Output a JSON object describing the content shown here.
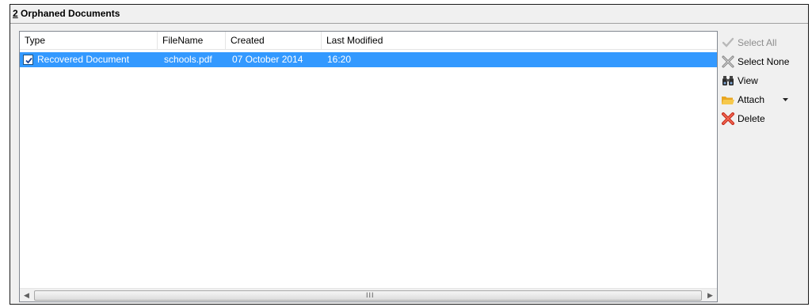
{
  "panel": {
    "number": "2",
    "title": "Orphaned Documents"
  },
  "list": {
    "columns": [
      "Type",
      "FileName",
      "Created",
      "Last Modified"
    ],
    "rows": [
      {
        "checked": true,
        "type": "Recovered Document",
        "filename": "schools.pdf",
        "created": "07 October 2014",
        "last_modified": "16:20"
      }
    ]
  },
  "actions": {
    "select_all": "Select All",
    "select_none": "Select None",
    "view": "View",
    "attach": "Attach",
    "delete": "Delete"
  },
  "colors": {
    "selection": "#3399ff",
    "disabled_text": "#8d8d8d",
    "delete_icon": "#e8402a",
    "folder_icon": "#f2b737"
  },
  "icons": {
    "select_all": "check-icon",
    "select_none": "cross-icon",
    "view": "binoculars-icon",
    "attach": "folder-icon",
    "delete": "delete-x-icon"
  }
}
